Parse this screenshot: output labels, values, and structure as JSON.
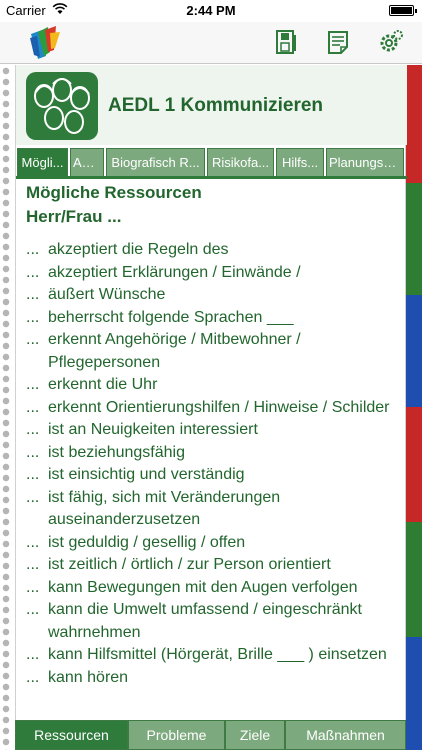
{
  "status_bar": {
    "carrier": "Carrier",
    "time": "2:44 PM"
  },
  "navbar": {
    "logo": "app-logo",
    "buttons": [
      "save-icon",
      "notes-icon",
      "settings-icon"
    ]
  },
  "page": {
    "title": "AEDL 1 Kommunizieren",
    "tabs": [
      {
        "label": "Mögli...",
        "active": true
      },
      {
        "label": "AE...",
        "active": false
      },
      {
        "label": "Biografisch R...",
        "active": false
      },
      {
        "label": "Risikofa...",
        "active": false
      },
      {
        "label": "Hilfs...",
        "active": false
      },
      {
        "label": "Planungsb...",
        "active": false
      }
    ],
    "section_title": "Mögliche Ressourcen",
    "section_subtitle": "Herr/Frau ...",
    "list_prefix": "...",
    "items": [
      "akzeptiert die Regeln des",
      "akzeptiert Erklärungen / Einwände /",
      "äußert Wünsche",
      "beherrscht folgende Sprachen ___",
      "erkennt Angehörige / Mitbewohner / Pflegepersonen",
      "erkennt die Uhr",
      "erkennt Orientierungshilfen / Hinweise / Schilder",
      "ist an Neuigkeiten interessiert",
      "ist beziehungsfähig",
      "ist einsichtig und verständig",
      "ist fähig, sich mit Veränderungen auseinanderzusetzen",
      "ist geduldig / gesellig / offen",
      "ist zeitlich / örtlich / zur Person orientiert",
      "kann Bewegungen mit den Augen verfolgen",
      "kann die Umwelt umfassend / eingeschränkt wahrnehmen",
      "kann Hilfsmittel (Hörgerät, Brille ___ ) einsetzen",
      "kann hören"
    ]
  },
  "bottom_tabs": [
    {
      "label": "Ressourcen",
      "active": true
    },
    {
      "label": "Probleme",
      "active": false
    },
    {
      "label": "Ziele",
      "active": false
    },
    {
      "label": "Maßnahmen",
      "active": false
    }
  ],
  "colors": {
    "accent": "#2e7b3c",
    "tab_inactive": "#7da97f",
    "text": "#22662e",
    "right_tabs": [
      "#c62828",
      "#2e7d32",
      "#1e4fb0",
      "#c62828",
      "#2e7d32",
      "#1e4fb0"
    ]
  }
}
